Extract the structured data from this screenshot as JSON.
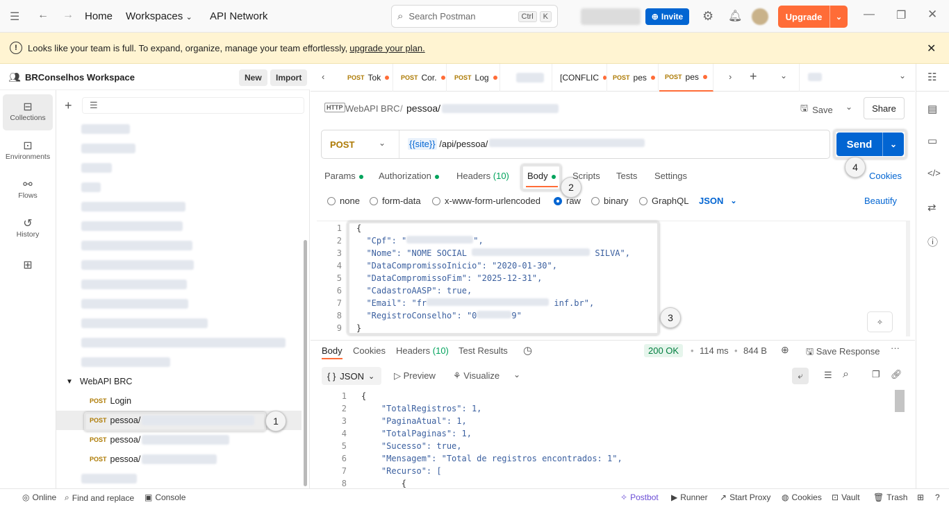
{
  "topbar": {
    "home": "Home",
    "workspaces": "Workspaces",
    "api_network": "API Network",
    "search_placeholder": "Search Postman",
    "search_kbd1": "Ctrl",
    "search_kbd2": "K",
    "invite": "Invite",
    "upgrade": "Upgrade"
  },
  "banner": {
    "text": "Looks like your team is full. To expand, organize, manage your team effortlessly, ",
    "link": "upgrade your plan."
  },
  "workspace": {
    "name": "BRConselhos Workspace",
    "new": "New",
    "import": "Import"
  },
  "left_nav": [
    {
      "label": "Collections",
      "icon": "collections-icon"
    },
    {
      "label": "Environments",
      "icon": "environments-icon"
    },
    {
      "label": "Flows",
      "icon": "flows-icon"
    },
    {
      "label": "History",
      "icon": "history-icon"
    }
  ],
  "tree": {
    "folder": "WebAPI BRC",
    "items": [
      {
        "method": "POST",
        "name": "Login"
      },
      {
        "method": "POST",
        "name": "pessoa/"
      },
      {
        "method": "POST",
        "name": "pessoa/"
      },
      {
        "method": "POST",
        "name": "pessoa/"
      }
    ]
  },
  "tabs": [
    {
      "method": "POST",
      "name": "Tok"
    },
    {
      "method": "POST",
      "name": "Cor."
    },
    {
      "method": "POST",
      "name": "Log"
    },
    {
      "method": "",
      "name": "[CONFLIC"
    },
    {
      "method": "POST",
      "name": "pes"
    },
    {
      "method": "POST",
      "name": "pes"
    }
  ],
  "request": {
    "breadcrumb_parent": "WebAPI BRC",
    "breadcrumb_sep": "/",
    "breadcrumb_name": "pessoa/",
    "save": "Save",
    "share": "Share",
    "method": "POST",
    "url_var": "{{site}}",
    "url_path": " /api/pessoa/",
    "send": "Send",
    "cookies": "Cookies",
    "beautify": "Beautify"
  },
  "req_tabs": [
    {
      "label": "Params"
    },
    {
      "label": "Authorization"
    },
    {
      "label": "Headers",
      "count": "(10)"
    },
    {
      "label": "Body"
    },
    {
      "label": "Scripts"
    },
    {
      "label": "Tests"
    },
    {
      "label": "Settings"
    }
  ],
  "body_types": [
    "none",
    "form-data",
    "x-www-form-urlencoded",
    "raw",
    "binary",
    "GraphQL"
  ],
  "body_format": "JSON",
  "body_lines": [
    "{",
    "  \"Cpf\": \"",
    "  \"Nome\": \"NOME SOCIAL ",
    "  \"DataCompromissoInicio\": \"2020-01-30\",",
    "  \"DataCompromissoFim\": \"2025-12-31\",",
    "  \"CadastroAASP\": true,",
    "  \"Email\": \"fr",
    "  \"RegistroConselho\": \"0",
    "}"
  ],
  "body_tails": {
    "cpf": "\",",
    "nome": " SILVA\",",
    "email": " inf.br\",",
    "registro": "9\""
  },
  "callouts": [
    "1",
    "2",
    "3",
    "4"
  ],
  "response": {
    "tabs": [
      "Body",
      "Cookies",
      "Headers",
      "Test Results"
    ],
    "headers_count": "(10)",
    "status": "200 OK",
    "time": "114 ms",
    "size": "844 B",
    "save_response": "Save Response",
    "format": "JSON",
    "preview": "Preview",
    "visualize": "Visualize"
  },
  "resp_lines": [
    "{",
    "    \"TotalRegistros\": 1,",
    "    \"PaginaAtual\": 1,",
    "    \"TotalPaginas\": 1,",
    "    \"Sucesso\": true,",
    "    \"Mensagem\": \"Total de registros encontrados: 1\",",
    "    \"Recurso\": [",
    "        {"
  ],
  "statusbar": {
    "online": "Online",
    "find": "Find and replace",
    "console": "Console",
    "postbot": "Postbot",
    "runner": "Runner",
    "proxy": "Start Proxy",
    "cookies": "Cookies",
    "vault": "Vault",
    "trash": "Trash"
  }
}
